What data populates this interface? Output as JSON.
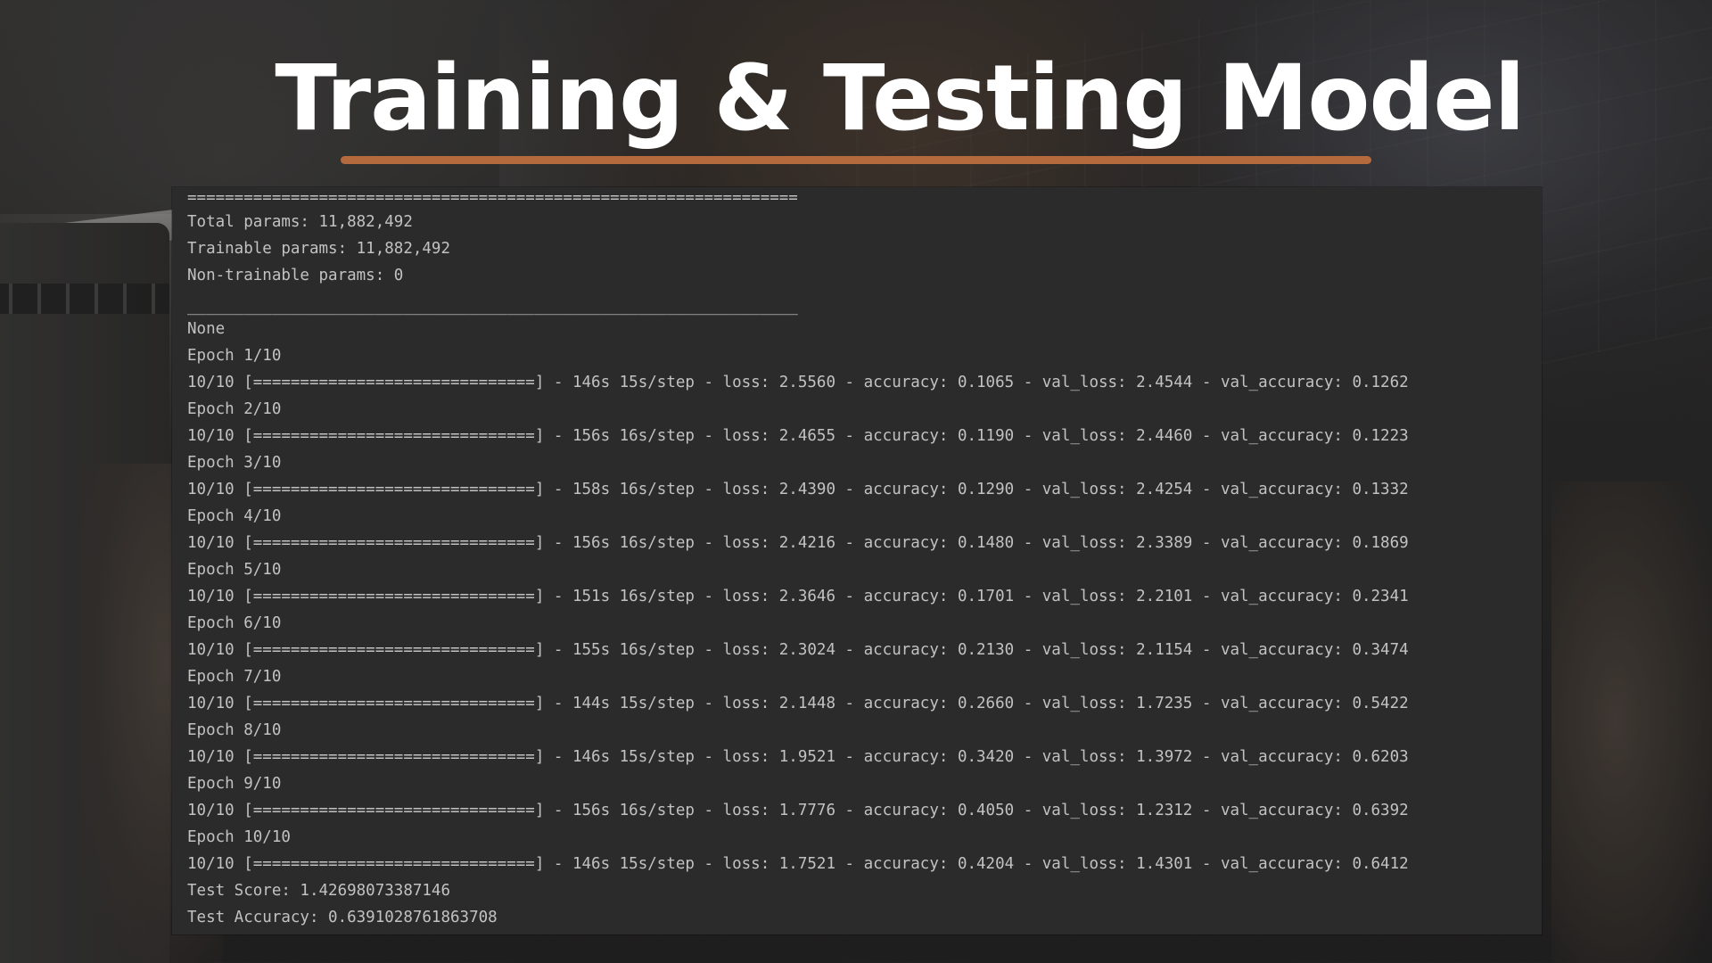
{
  "slide": {
    "title": "Training & Testing Model"
  },
  "console": {
    "separator_top": "=================================================================",
    "total_params": "Total params: 11,882,492",
    "trainable_params": "Trainable params: 11,882,492",
    "non_trainable_params": "Non-trainable params: 0",
    "separator_bottom": "_________________________________________________________________",
    "none_line": "None",
    "epochs": [
      {
        "header": "Epoch 1/10",
        "progress": "10/10 [==============================] - 146s 15s/step - loss: 2.5560 - accuracy: 0.1065 - val_loss: 2.4544 - val_accuracy: 0.1262"
      },
      {
        "header": "Epoch 2/10",
        "progress": "10/10 [==============================] - 156s 16s/step - loss: 2.4655 - accuracy: 0.1190 - val_loss: 2.4460 - val_accuracy: 0.1223"
      },
      {
        "header": "Epoch 3/10",
        "progress": "10/10 [==============================] - 158s 16s/step - loss: 2.4390 - accuracy: 0.1290 - val_loss: 2.4254 - val_accuracy: 0.1332"
      },
      {
        "header": "Epoch 4/10",
        "progress": "10/10 [==============================] - 156s 16s/step - loss: 2.4216 - accuracy: 0.1480 - val_loss: 2.3389 - val_accuracy: 0.1869"
      },
      {
        "header": "Epoch 5/10",
        "progress": "10/10 [==============================] - 151s 16s/step - loss: 2.3646 - accuracy: 0.1701 - val_loss: 2.2101 - val_accuracy: 0.2341"
      },
      {
        "header": "Epoch 6/10",
        "progress": "10/10 [==============================] - 155s 16s/step - loss: 2.3024 - accuracy: 0.2130 - val_loss: 2.1154 - val_accuracy: 0.3474"
      },
      {
        "header": "Epoch 7/10",
        "progress": "10/10 [==============================] - 144s 15s/step - loss: 2.1448 - accuracy: 0.2660 - val_loss: 1.7235 - val_accuracy: 0.5422"
      },
      {
        "header": "Epoch 8/10",
        "progress": "10/10 [==============================] - 146s 15s/step - loss: 1.9521 - accuracy: 0.3420 - val_loss: 1.3972 - val_accuracy: 0.6203"
      },
      {
        "header": "Epoch 9/10",
        "progress": "10/10 [==============================] - 156s 16s/step - loss: 1.7776 - accuracy: 0.4050 - val_loss: 1.2312 - val_accuracy: 0.6392"
      },
      {
        "header": "Epoch 10/10",
        "progress": "10/10 [==============================] - 146s 15s/step - loss: 1.7521 - accuracy: 0.4204 - val_loss: 1.4301 - val_accuracy: 0.6412"
      }
    ],
    "test_score": "Test Score: 1.42698073387146",
    "test_accuracy": "Test Accuracy: 0.6391028761863708"
  },
  "colors": {
    "title_text": "#ffffff",
    "underline": "#b46a3c",
    "console_bg": "#2b2b2b",
    "console_text": "#c2c2c2"
  }
}
